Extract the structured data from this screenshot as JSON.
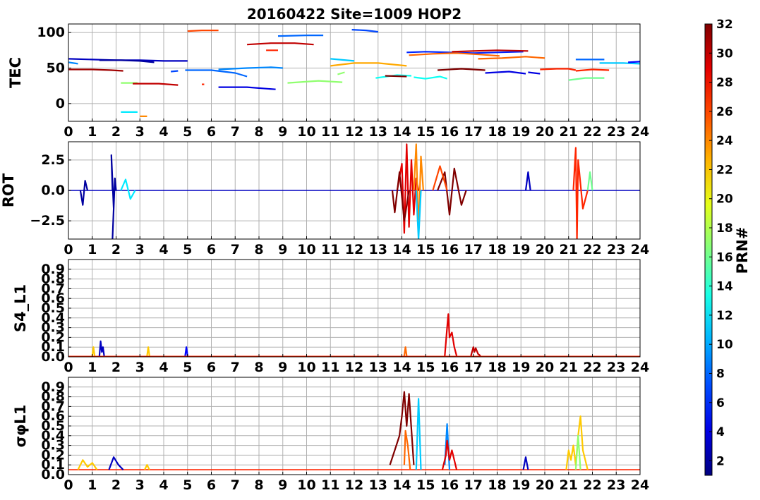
{
  "figure": {
    "title": "20160422 Site=1009 HOP2",
    "colorbar": {
      "label": "PRN#",
      "min": 1,
      "max": 32,
      "ticks": [
        "2",
        "4",
        "6",
        "8",
        "10",
        "12",
        "14",
        "16",
        "18",
        "20",
        "22",
        "24",
        "26",
        "28",
        "30",
        "32"
      ]
    },
    "x_ticks": [
      "0",
      "1",
      "2",
      "3",
      "4",
      "5",
      "6",
      "7",
      "8",
      "9",
      "10",
      "11",
      "12",
      "13",
      "14",
      "15",
      "16",
      "17",
      "18",
      "19",
      "20",
      "21",
      "22",
      "23",
      "24"
    ]
  },
  "chart_data": [
    {
      "type": "line",
      "ylabel": "TEC",
      "xlim": [
        0,
        24
      ],
      "ylim": [
        -25,
        112
      ],
      "yticks": [
        "0",
        "50",
        "100"
      ],
      "ytick_values": [
        0,
        50,
        100
      ],
      "grid": true,
      "series": [
        {
          "prn": 3,
          "x": [
            0.0,
            1.0,
            2.0,
            3.0,
            4.0,
            5.0
          ],
          "y": [
            63,
            62,
            61,
            61,
            60,
            60
          ]
        },
        {
          "prn": 2,
          "x": [
            1.3,
            2.2,
            3.0,
            3.6
          ],
          "y": [
            61,
            61,
            60,
            58
          ]
        },
        {
          "prn": 31,
          "x": [
            0.0,
            1.0,
            1.8,
            2.3
          ],
          "y": [
            48,
            48,
            47,
            46
          ]
        },
        {
          "prn": 9,
          "x": [
            0.0,
            0.4
          ],
          "y": [
            58,
            56
          ]
        },
        {
          "prn": 17,
          "x": [
            2.2,
            2.9
          ],
          "y": [
            29,
            29
          ]
        },
        {
          "prn": 12,
          "x": [
            2.2,
            2.9
          ],
          "y": [
            -12,
            -12
          ]
        },
        {
          "prn": 24,
          "x": [
            3.0,
            3.3
          ],
          "y": [
            -18,
            -18
          ]
        },
        {
          "prn": 30,
          "x": [
            2.7,
            3.8,
            4.6
          ],
          "y": [
            28,
            28,
            26
          ]
        },
        {
          "prn": 26,
          "x": [
            5.0,
            5.6,
            6.3
          ],
          "y": [
            102,
            103,
            103
          ]
        },
        {
          "prn": 7,
          "x": [
            4.3,
            4.6
          ],
          "y": [
            45,
            46
          ]
        },
        {
          "prn": 8,
          "x": [
            4.9,
            6.0,
            7.0,
            7.5
          ],
          "y": [
            47,
            47,
            43,
            38
          ]
        },
        {
          "prn": 9,
          "x": [
            6.3,
            7.5,
            8.5,
            9.0
          ],
          "y": [
            48,
            50,
            51,
            50
          ]
        },
        {
          "prn": 4,
          "x": [
            6.3,
            7.5,
            8.7
          ],
          "y": [
            23,
            23,
            20
          ]
        },
        {
          "prn": 27,
          "x": [
            5.6,
            5.7
          ],
          "y": [
            27,
            27
          ]
        },
        {
          "prn": 30,
          "x": [
            7.5,
            8.5,
            9.5,
            10.3
          ],
          "y": [
            83,
            85,
            85,
            83
          ]
        },
        {
          "prn": 27,
          "x": [
            8.3,
            8.8
          ],
          "y": [
            75,
            75
          ]
        },
        {
          "prn": 8,
          "x": [
            8.8,
            10.0,
            10.7
          ],
          "y": [
            95,
            96,
            96
          ]
        },
        {
          "prn": 17,
          "x": [
            9.2,
            10.5,
            11.5
          ],
          "y": [
            29,
            32,
            30
          ]
        },
        {
          "prn": 17,
          "x": [
            11.3,
            11.6
          ],
          "y": [
            41,
            44
          ]
        },
        {
          "prn": 7,
          "x": [
            11.9,
            12.5,
            13.0
          ],
          "y": [
            104,
            103,
            101
          ]
        },
        {
          "prn": 11,
          "x": [
            11.0,
            12.0
          ],
          "y": [
            63,
            60
          ]
        },
        {
          "prn": 23,
          "x": [
            11.0,
            12.0,
            13.0,
            14.2
          ],
          "y": [
            53,
            57,
            57,
            53
          ]
        },
        {
          "prn": 13,
          "x": [
            12.9,
            13.8,
            14.4
          ],
          "y": [
            36,
            40,
            39
          ]
        },
        {
          "prn": 32,
          "x": [
            13.3,
            14.2
          ],
          "y": [
            39,
            38
          ]
        },
        {
          "prn": 13,
          "x": [
            14.5,
            15.0,
            15.6,
            15.9
          ],
          "y": [
            37,
            35,
            38,
            35
          ]
        },
        {
          "prn": 6,
          "x": [
            14.2,
            15.0,
            16.0,
            17.0,
            18.0,
            19.1
          ],
          "y": [
            72,
            73,
            72,
            71,
            72,
            73
          ]
        },
        {
          "prn": 25,
          "x": [
            14.3,
            15.3,
            16.3,
            17.3,
            18.1
          ],
          "y": [
            68,
            70,
            71,
            69,
            67
          ]
        },
        {
          "prn": 30,
          "x": [
            16.1,
            17.0,
            18.0,
            19.3
          ],
          "y": [
            73,
            74,
            75,
            74
          ]
        },
        {
          "prn": 32,
          "x": [
            15.5,
            16.5,
            17.5
          ],
          "y": [
            47,
            49,
            47
          ]
        },
        {
          "prn": 25,
          "x": [
            17.2,
            18.2,
            19.2,
            20.0
          ],
          "y": [
            63,
            64,
            66,
            64
          ]
        },
        {
          "prn": 4,
          "x": [
            17.5,
            18.5,
            19.2
          ],
          "y": [
            43,
            45,
            42
          ]
        },
        {
          "prn": 4,
          "x": [
            19.3,
            19.8
          ],
          "y": [
            44,
            42
          ]
        },
        {
          "prn": 27,
          "x": [
            19.8,
            20.5,
            21.0,
            21.3
          ],
          "y": [
            48,
            49,
            49,
            47
          ]
        },
        {
          "prn": 27,
          "x": [
            21.3,
            22.0,
            22.7
          ],
          "y": [
            46,
            48,
            47
          ]
        },
        {
          "prn": 16,
          "x": [
            21.0,
            21.7,
            22.5
          ],
          "y": [
            33,
            36,
            36
          ]
        },
        {
          "prn": 8,
          "x": [
            21.3,
            22.5
          ],
          "y": [
            62,
            62
          ]
        },
        {
          "prn": 11,
          "x": [
            22.3,
            23.3,
            24.0
          ],
          "y": [
            57,
            57,
            56
          ]
        },
        {
          "prn": 5,
          "x": [
            23.5,
            24.0
          ],
          "y": [
            58,
            59
          ]
        }
      ]
    },
    {
      "type": "line",
      "ylabel": "ROT",
      "xlim": [
        0,
        24
      ],
      "ylim": [
        -4,
        4
      ],
      "yticks": [
        "−2.5",
        "0.0",
        "2.5"
      ],
      "ytick_values": [
        -2.5,
        0,
        2.5
      ],
      "grid": true,
      "series": [
        {
          "prn": 3,
          "role": "background",
          "x": [
            0,
            24
          ],
          "y": [
            0,
            0
          ]
        },
        {
          "prn": 2,
          "x": [
            1.85,
            1.8,
            1.9,
            1.85,
            1.95,
            2.0
          ],
          "y": [
            0,
            2.9,
            -1.5,
            -4.0,
            1.0,
            0.0
          ]
        },
        {
          "prn": 2,
          "x": [
            0.5,
            0.6,
            0.7,
            0.8
          ],
          "y": [
            0,
            -1.2,
            0.8,
            0.0
          ]
        },
        {
          "prn": 12,
          "x": [
            2.2,
            2.4,
            2.6,
            2.8
          ],
          "y": [
            0,
            0.9,
            -0.7,
            0.0
          ]
        },
        {
          "prn": 29,
          "x": [
            13.8,
            14.0,
            14.1,
            14.2,
            14.3,
            14.4,
            14.5,
            14.6,
            14.7
          ],
          "y": [
            0,
            2.2,
            -3.5,
            3.8,
            -3.0,
            2.5,
            -2.0,
            1.0,
            0
          ]
        },
        {
          "prn": 32,
          "x": [
            13.6,
            13.7,
            13.9,
            14.1,
            14.3
          ],
          "y": [
            0,
            -1.8,
            1.5,
            -2.5,
            0
          ]
        },
        {
          "prn": 24,
          "x": [
            14.5,
            14.6,
            14.7,
            14.8,
            14.9
          ],
          "y": [
            0,
            3.8,
            -3.5,
            2.8,
            0
          ]
        },
        {
          "prn": 11,
          "x": [
            14.6,
            14.7,
            14.8
          ],
          "y": [
            0,
            -4.0,
            0
          ]
        },
        {
          "prn": 32,
          "x": [
            15.5,
            15.8,
            16.0,
            16.2,
            16.5,
            16.7
          ],
          "y": [
            0,
            1.5,
            -2.0,
            1.8,
            -1.2,
            0
          ]
        },
        {
          "prn": 26,
          "x": [
            15.3,
            15.6,
            15.9
          ],
          "y": [
            0,
            2.0,
            0
          ]
        },
        {
          "prn": 3,
          "x": [
            19.2,
            19.3,
            19.4
          ],
          "y": [
            0,
            1.5,
            0
          ]
        },
        {
          "prn": 27,
          "x": [
            21.2,
            21.3,
            21.35,
            21.4,
            21.6,
            21.8
          ],
          "y": [
            0,
            3.5,
            -4.0,
            2.5,
            -1.5,
            0
          ]
        },
        {
          "prn": 16,
          "x": [
            21.8,
            21.9,
            22.0
          ],
          "y": [
            0,
            1.5,
            0
          ]
        }
      ]
    },
    {
      "type": "line",
      "ylabel": "S4_L1",
      "xlim": [
        0,
        24
      ],
      "ylim": [
        0,
        1
      ],
      "yticks": [
        "0.0",
        "0.1",
        "0.2",
        "0.3",
        "0.4",
        "0.5",
        "0.6",
        "0.7",
        "0.8",
        "0.9"
      ],
      "ytick_values": [
        0,
        0.1,
        0.2,
        0.3,
        0.4,
        0.5,
        0.6,
        0.7,
        0.8,
        0.9
      ],
      "grid": true,
      "series": [
        {
          "prn": 27,
          "role": "background",
          "x": [
            0,
            24
          ],
          "y": [
            0.005,
            0.005
          ]
        },
        {
          "prn": 22,
          "x": [
            1.0,
            1.05,
            1.1
          ],
          "y": [
            0.01,
            0.1,
            0.01
          ]
        },
        {
          "prn": 3,
          "x": [
            1.3,
            1.35,
            1.4,
            1.45,
            1.5
          ],
          "y": [
            0.01,
            0.16,
            0.05,
            0.1,
            0.01
          ]
        },
        {
          "prn": 22,
          "x": [
            3.3,
            3.35,
            3.4
          ],
          "y": [
            0.01,
            0.1,
            0.01
          ]
        },
        {
          "prn": 5,
          "x": [
            4.9,
            4.95,
            5.0
          ],
          "y": [
            0.01,
            0.1,
            0.01
          ]
        },
        {
          "prn": 25,
          "x": [
            14.1,
            14.15,
            14.2
          ],
          "y": [
            0.01,
            0.1,
            0.01
          ]
        },
        {
          "prn": 29,
          "x": [
            15.8,
            15.9,
            15.95,
            16.0,
            16.1,
            16.2,
            16.3
          ],
          "y": [
            0.01,
            0.3,
            0.44,
            0.2,
            0.25,
            0.1,
            0.01
          ]
        },
        {
          "prn": 30,
          "x": [
            16.9,
            17.0,
            17.05,
            17.1,
            17.2,
            17.3
          ],
          "y": [
            0.01,
            0.1,
            0.05,
            0.09,
            0.03,
            0.01
          ]
        }
      ]
    },
    {
      "type": "line",
      "ylabel": "σφL1",
      "xlim": [
        0,
        24
      ],
      "ylim": [
        0,
        1
      ],
      "yticks": [
        "0.0",
        "0.1",
        "0.2",
        "0.3",
        "0.4",
        "0.5",
        "0.6",
        "0.7",
        "0.8",
        "0.9"
      ],
      "ytick_values": [
        0,
        0.1,
        0.2,
        0.3,
        0.4,
        0.5,
        0.6,
        0.7,
        0.8,
        0.9
      ],
      "grid": true,
      "series": [
        {
          "prn": 27,
          "role": "background",
          "x": [
            0,
            24
          ],
          "y": [
            0.05,
            0.05
          ]
        },
        {
          "prn": 22,
          "x": [
            0.4,
            0.6,
            0.8,
            1.0,
            1.2
          ],
          "y": [
            0.05,
            0.15,
            0.08,
            0.12,
            0.05
          ]
        },
        {
          "prn": 3,
          "x": [
            1.7,
            1.9,
            2.1,
            2.3
          ],
          "y": [
            0.05,
            0.18,
            0.1,
            0.05
          ]
        },
        {
          "prn": 22,
          "x": [
            3.2,
            3.3,
            3.4
          ],
          "y": [
            0.05,
            0.1,
            0.05
          ]
        },
        {
          "prn": 32,
          "x": [
            13.5,
            13.7,
            13.9,
            14.0,
            14.1,
            14.2,
            14.3,
            14.5
          ],
          "y": [
            0.1,
            0.25,
            0.4,
            0.6,
            0.85,
            0.5,
            0.83,
            0.1
          ]
        },
        {
          "prn": 25,
          "x": [
            14.1,
            14.15,
            14.25,
            14.35
          ],
          "y": [
            0.1,
            0.45,
            0.3,
            0.05
          ]
        },
        {
          "prn": 11,
          "x": [
            14.6,
            14.7,
            14.8
          ],
          "y": [
            0.05,
            0.78,
            0.05
          ]
        },
        {
          "prn": 9,
          "x": [
            15.8,
            15.9,
            16.0
          ],
          "y": [
            0.1,
            0.52,
            0.05
          ]
        },
        {
          "prn": 29,
          "x": [
            15.7,
            15.85,
            15.9,
            16.0,
            16.1,
            16.3
          ],
          "y": [
            0.05,
            0.2,
            0.35,
            0.15,
            0.25,
            0.05
          ]
        },
        {
          "prn": 3,
          "x": [
            19.1,
            19.2,
            19.3
          ],
          "y": [
            0.05,
            0.18,
            0.05
          ]
        },
        {
          "prn": 22,
          "x": [
            20.9,
            21.0,
            21.1,
            21.2,
            21.3,
            21.4,
            21.5,
            21.6,
            21.8
          ],
          "y": [
            0.05,
            0.25,
            0.15,
            0.3,
            0.1,
            0.4,
            0.6,
            0.25,
            0.05
          ]
        },
        {
          "prn": 17,
          "x": [
            21.3,
            21.4,
            21.5
          ],
          "y": [
            0.05,
            0.4,
            0.05
          ]
        }
      ]
    }
  ]
}
